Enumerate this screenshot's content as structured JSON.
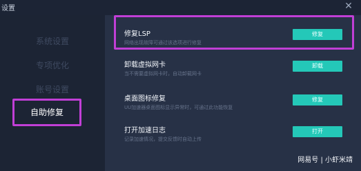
{
  "window": {
    "title": "设置",
    "close_icon": "close-icon"
  },
  "sidebar": {
    "items": [
      {
        "label": "系统设置"
      },
      {
        "label": "专项优化"
      },
      {
        "label": "账号设置"
      },
      {
        "label": "自助修复"
      }
    ]
  },
  "content": {
    "rows": [
      {
        "title": "修复LSP",
        "desc": "网络出现故障可通过该选项进行修复",
        "button": "修复"
      },
      {
        "title": "卸载虚拟网卡",
        "desc": "当不需要虚拟网卡时，自动卸载网卡",
        "button": "卸载"
      },
      {
        "title": "桌面图标修复",
        "desc": "UU加速器桌面图标显示异常时，可通过此功能恢复",
        "button": "修复"
      },
      {
        "title": "打开加速日志",
        "desc": "记录加速情况，提交反馈时自动上传",
        "button": "打开"
      }
    ]
  },
  "watermark": "网易号 | 小虾米靖",
  "colors": {
    "accent": "#24c8b8",
    "highlight": "#c13fd6"
  }
}
